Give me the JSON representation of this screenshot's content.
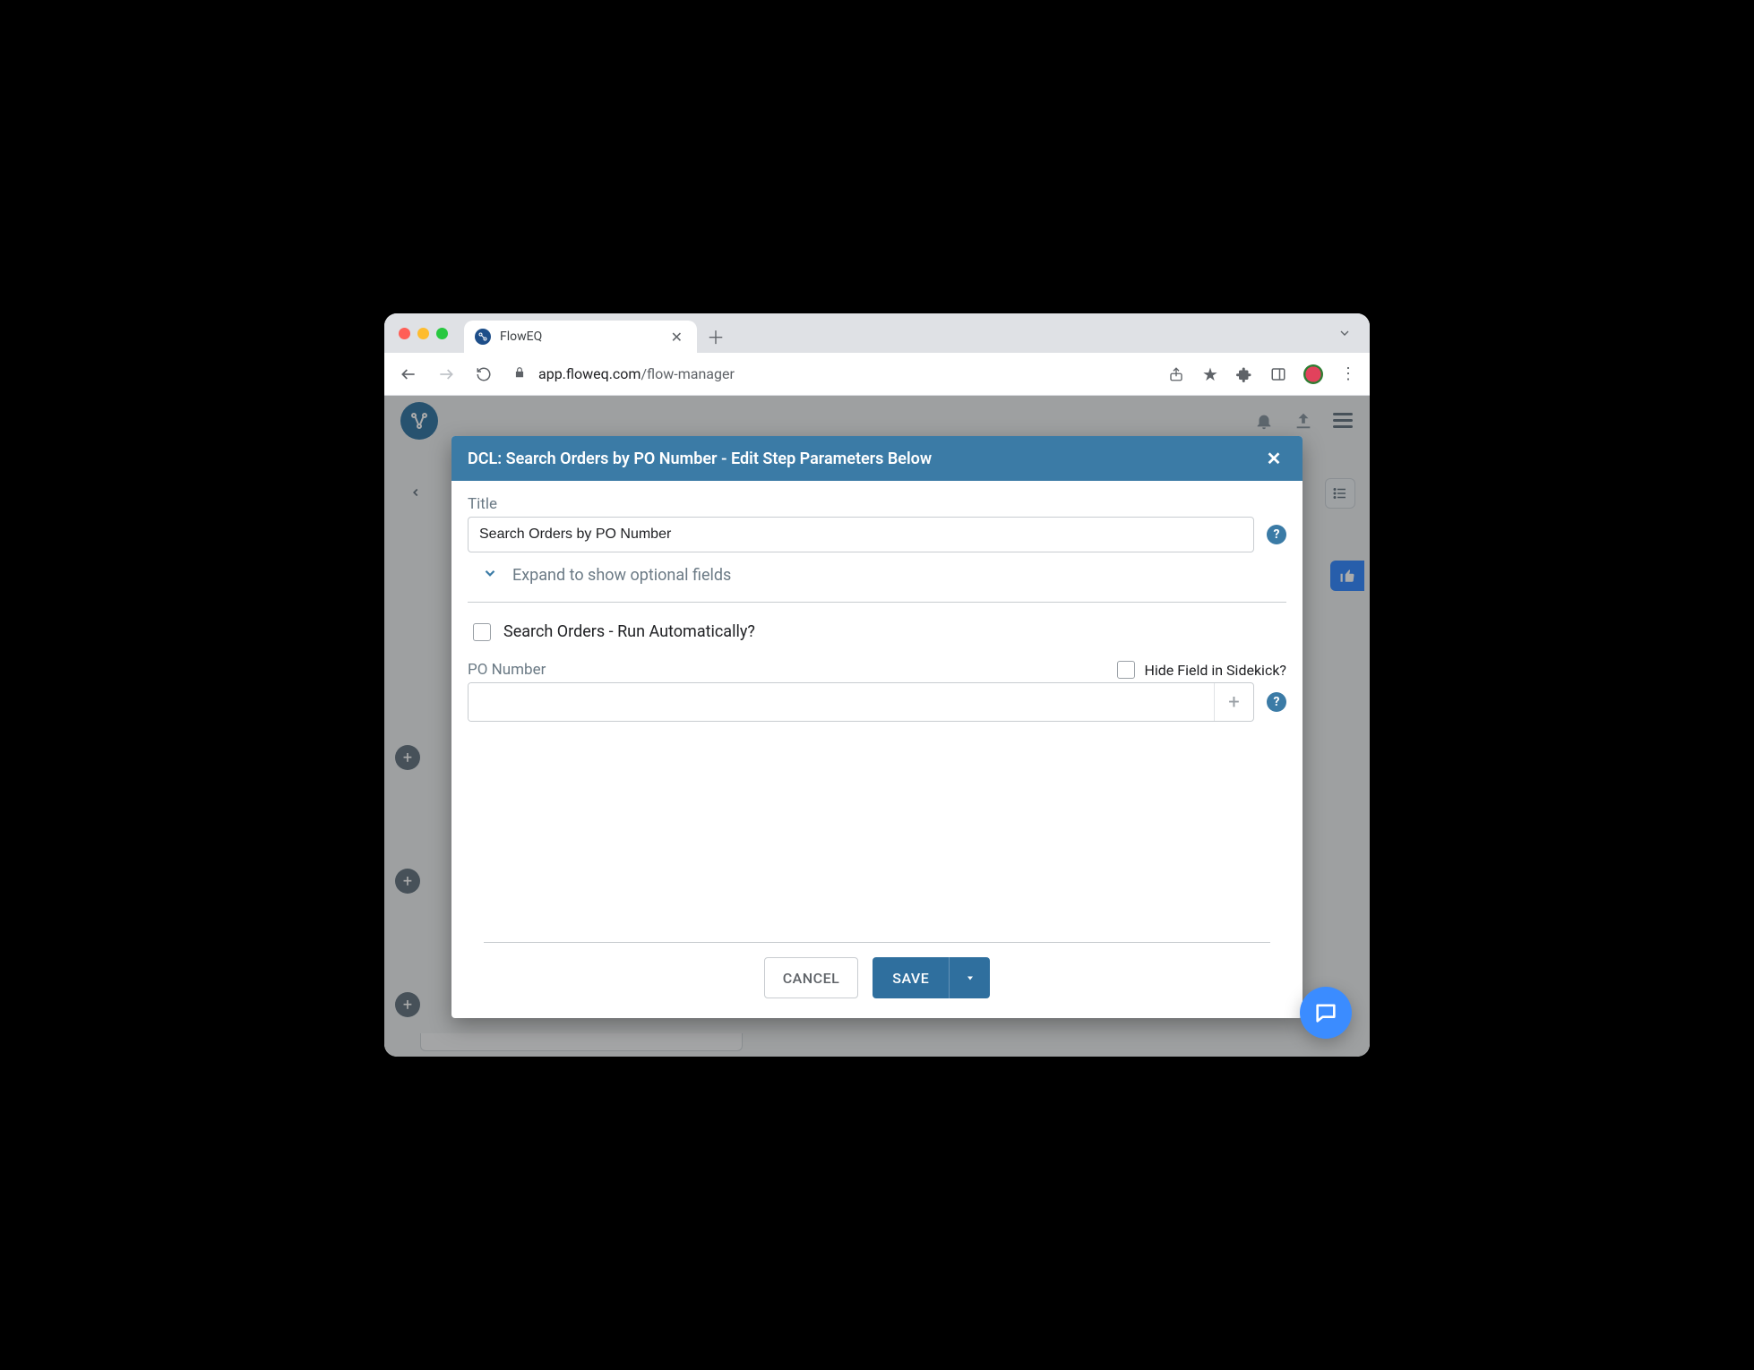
{
  "browser": {
    "tab_title": "FlowEQ",
    "url_domain": "app.floweq.com",
    "url_path": "/flow-manager"
  },
  "modal": {
    "header_title": "DCL: Search Orders by PO Number - Edit Step Parameters Below",
    "title_label": "Title",
    "title_value": "Search Orders by PO Number",
    "expand_label": "Expand to show optional fields",
    "run_auto_label": "Search Orders - Run Automatically?",
    "run_auto_checked": false,
    "po_label": "PO Number",
    "po_value": "",
    "hide_field_label": "Hide Field in Sidekick?",
    "hide_field_checked": false,
    "help_glyph": "?",
    "plus_glyph": "+",
    "cancel_label": "CANCEL",
    "save_label": "SAVE"
  }
}
